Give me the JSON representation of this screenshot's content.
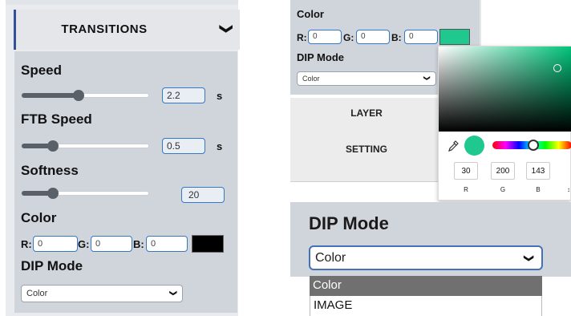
{
  "transitions": {
    "header": "TRANSITIONS",
    "speed": {
      "label": "Speed",
      "value": "2.2",
      "unit": "s",
      "level": 0.38
    },
    "ftb": {
      "label": "FTB Speed",
      "value": "0.5",
      "unit": "s",
      "level": 0.22
    },
    "softness": {
      "label": "Softness",
      "value": "20",
      "level": 0.22
    },
    "color": {
      "label": "Color",
      "r_label": "R:",
      "g_label": "G:",
      "b_label": "B:",
      "r": "0",
      "g": "0",
      "b": "0",
      "swatch": "#000000"
    },
    "dip": {
      "label": "DIP Mode",
      "selected": "Color"
    }
  },
  "picker_panel": {
    "color_label": "Color",
    "r_label": "R:",
    "g_label": "G:",
    "b_label": "B:",
    "r": "0",
    "g": "0",
    "b": "0",
    "swatch": "#1ec88f",
    "dip_label": "DIP Mode",
    "dip_selected": "Color",
    "menu": [
      "LAYER",
      "SETTING"
    ],
    "picker": {
      "values": [
        "30",
        "200",
        "143"
      ],
      "labels": [
        "R",
        "G",
        "B"
      ],
      "toggle": "↕",
      "preview": "#1ec88f"
    }
  },
  "dropdown_panel": {
    "title": "DIP Mode",
    "selected": "Color",
    "options": [
      "Color",
      "IMAGE"
    ]
  }
}
